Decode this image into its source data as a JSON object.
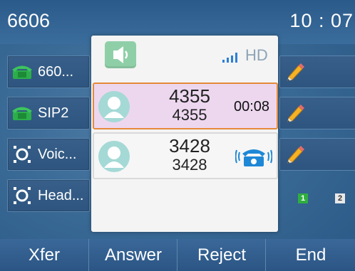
{
  "status_bar": {
    "extension": "6606",
    "time": "10 : 07"
  },
  "line_keys": [
    {
      "label": "660...",
      "icon": "phone-icon"
    },
    {
      "label": "SIP2",
      "icon": "phone-icon"
    },
    {
      "label": "Voic...",
      "icon": "voicemail-icon"
    },
    {
      "label": "Head...",
      "icon": "headset-icon"
    }
  ],
  "call_panel": {
    "audio_mode": "speaker-icon",
    "hd_label": "HD",
    "calls": [
      {
        "name": "4355",
        "number": "4355",
        "duration": "00:08",
        "state": "active"
      },
      {
        "name": "3428",
        "number": "3428",
        "state": "incoming"
      }
    ]
  },
  "account_indicators": [
    "1",
    "2"
  ],
  "softkeys": [
    {
      "label": "Xfer"
    },
    {
      "label": "Answer"
    },
    {
      "label": "Reject"
    },
    {
      "label": "End"
    }
  ],
  "colors": {
    "active_call_border": "#e58a3a",
    "active_call_bg": "#edd7ef",
    "speaker_bg": "#8fcfa8",
    "avatar_bg": "#a4d9d6",
    "incoming_phone_blue": "#1e88d6"
  }
}
